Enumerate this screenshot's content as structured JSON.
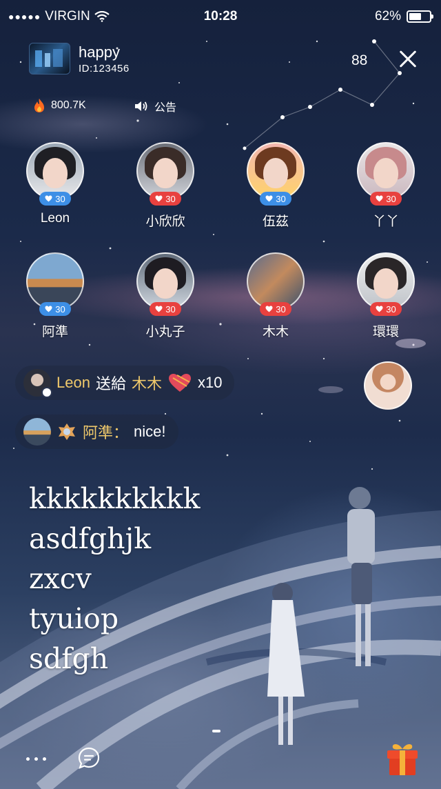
{
  "status_bar": {
    "carrier": "VIRGIN",
    "time": "10:28",
    "battery_percent": "62%",
    "battery_level": 0.62
  },
  "room": {
    "host_name": "happy",
    "host_id": "ID:123456",
    "viewer_count": "88",
    "heat": "800.7K",
    "notice_label": "公告"
  },
  "seats": [
    {
      "name": "Leon",
      "count": "30",
      "badge": "blue"
    },
    {
      "name": "小欣欣",
      "count": "30",
      "badge": "red"
    },
    {
      "name": "伍茲",
      "count": "30",
      "badge": "blue"
    },
    {
      "name": "丫丫",
      "count": "30",
      "badge": "red"
    },
    {
      "name": "阿準",
      "count": "30",
      "badge": "blue"
    },
    {
      "name": "小丸子",
      "count": "30",
      "badge": "red"
    },
    {
      "name": "木木",
      "count": "30",
      "badge": "red"
    },
    {
      "name": "環環",
      "count": "30",
      "badge": "red"
    }
  ],
  "chat": {
    "gift_message": {
      "sender": "Leon",
      "verb": "送給",
      "recipient": "木木",
      "quantity": "x10"
    },
    "text_message": {
      "sender": "阿準：",
      "text": "nice!"
    }
  },
  "big_text_lines": [
    "kkkkkkkkkk",
    "asdfghjk",
    "zxcv",
    "tyuiop",
    "sdfgh"
  ],
  "icons": {
    "flame": "flame-icon",
    "speaker": "speaker-icon",
    "close": "close-icon",
    "heart": "heart-icon",
    "more": "more-icon",
    "chat": "chat-bubble-icon",
    "gift": "gift-box-icon"
  },
  "colors": {
    "badge_blue": "#3d8fe6",
    "badge_red": "#e8413f",
    "gold_text": "#f0c96b",
    "flame": "#ff6a1f",
    "gift_box": "#ef4b2b"
  }
}
